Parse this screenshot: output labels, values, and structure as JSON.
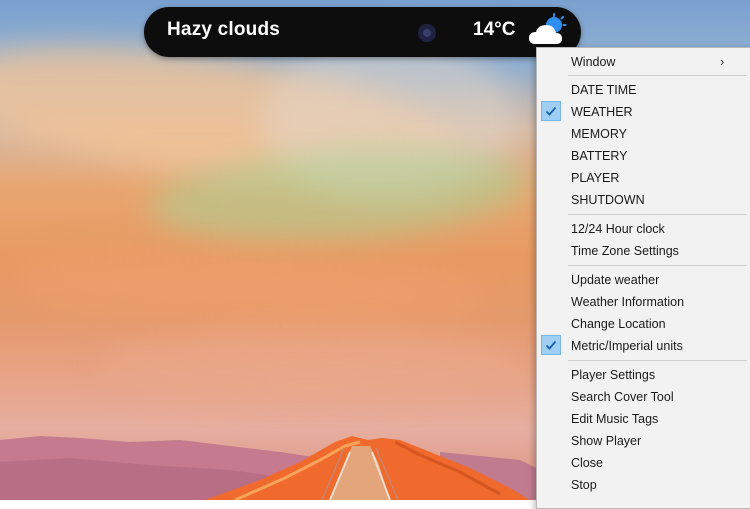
{
  "widget": {
    "description": "Hazy clouds",
    "temperature": "14°C",
    "condition_icon": "partly-cloudy-icon",
    "indicator_icon": "moon-icon"
  },
  "menu": {
    "window": "Window",
    "date_time": "DATE TIME",
    "weather": "WEATHER",
    "memory": "MEMORY",
    "battery": "BATTERY",
    "player": "PLAYER",
    "shutdown": "SHUTDOWN",
    "clock_format": "12/24 Hour clock",
    "time_zone": "Time Zone Settings",
    "update_weather": "Update weather",
    "weather_info": "Weather Information",
    "change_location": "Change Location",
    "units": "Metric/Imperial units",
    "player_settings": "Player Settings",
    "search_cover": "Search Cover Tool",
    "edit_tags": "Edit Music Tags",
    "show_player": "Show Player",
    "close": "Close",
    "stop": "Stop",
    "checked": [
      "WEATHER",
      "Metric/Imperial units"
    ]
  },
  "colors": {
    "widget_background": "#0d0d0d",
    "menu_background": "#f2f2f2",
    "check_highlight": "#9fd0f3"
  }
}
